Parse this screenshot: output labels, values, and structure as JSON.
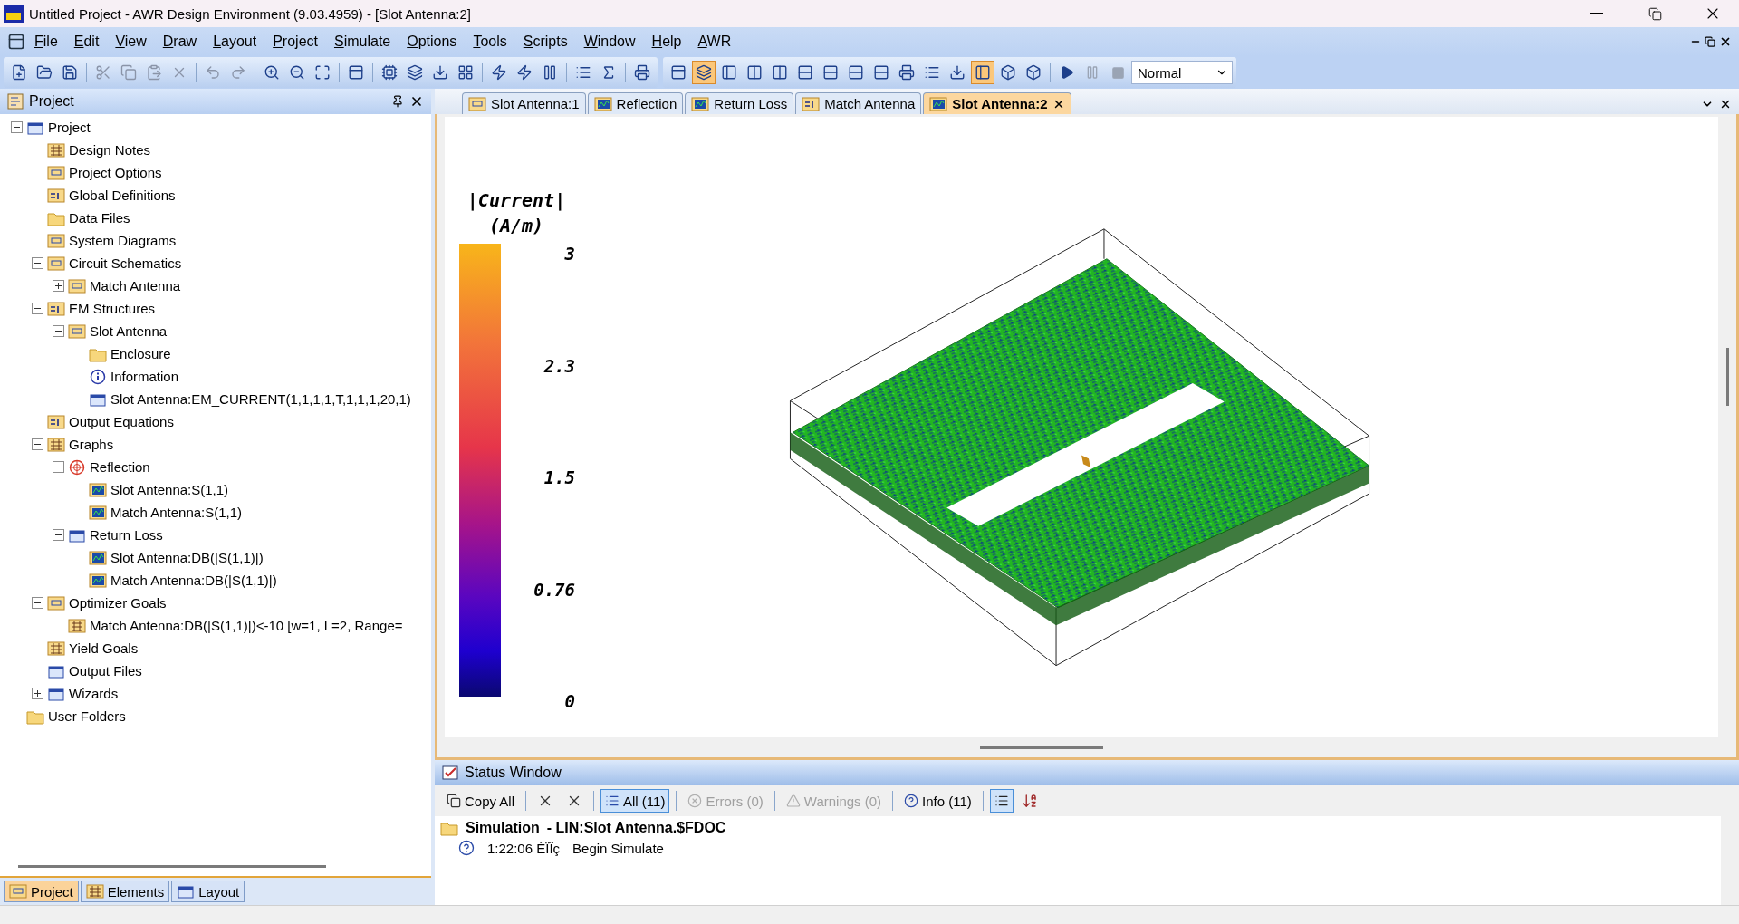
{
  "window": {
    "title": "Untitled Project - AWR Design Environment (9.03.4959) - [Slot Antenna:2]"
  },
  "menu": [
    "File",
    "Edit",
    "View",
    "Draw",
    "Layout",
    "Project",
    "Simulate",
    "Options",
    "Tools",
    "Scripts",
    "Window",
    "Help",
    "AWR"
  ],
  "toolbar": {
    "view_buttons": [
      {
        "active": false
      },
      {
        "active": true
      },
      {
        "active": false
      },
      {
        "active": false
      },
      {
        "active": false
      },
      {
        "active": false
      },
      {
        "active": false
      },
      {
        "active": false
      },
      {
        "active": false
      },
      {
        "active": false
      },
      {
        "active": false
      },
      {
        "active": false
      },
      {
        "active": true
      },
      {
        "active": false
      },
      {
        "active": false
      }
    ],
    "mode": "Normal"
  },
  "project_panel": {
    "title": "Project",
    "tree": [
      {
        "label": "Project",
        "kind": "box",
        "expanded": true,
        "children": [
          {
            "label": "Design Notes",
            "kind": "grid"
          },
          {
            "label": "Project Options",
            "kind": "document"
          },
          {
            "label": "Global Definitions",
            "kind": "equation"
          },
          {
            "label": "Data Files",
            "kind": "folder"
          },
          {
            "label": "System Diagrams",
            "kind": "document"
          },
          {
            "label": "Circuit Schematics",
            "kind": "document",
            "expanded": true,
            "children": [
              {
                "label": "Match Antenna",
                "kind": "document",
                "expanded": false
              }
            ]
          },
          {
            "label": "EM Structures",
            "kind": "equation",
            "expanded": true,
            "children": [
              {
                "label": "Slot Antenna",
                "kind": "document",
                "expanded": true,
                "children": [
                  {
                    "label": "Enclosure",
                    "kind": "folder"
                  },
                  {
                    "label": "Information",
                    "kind": "info"
                  },
                  {
                    "label": "Slot Antenna:EM_CURRENT(1,1,1,1,T,1,1,1,20,1)",
                    "kind": "box"
                  }
                ]
              }
            ]
          },
          {
            "label": "Output Equations",
            "kind": "equation"
          },
          {
            "label": "Graphs",
            "kind": "grid",
            "expanded": true,
            "children": [
              {
                "label": "Reflection",
                "kind": "smith",
                "expanded": true,
                "children": [
                  {
                    "label": "Slot Antenna:S(1,1)",
                    "kind": "chart"
                  },
                  {
                    "label": "Match Antenna:S(1,1)",
                    "kind": "chart"
                  }
                ]
              },
              {
                "label": "Return Loss",
                "kind": "box",
                "expanded": true,
                "children": [
                  {
                    "label": "Slot Antenna:DB(|S(1,1)|)",
                    "kind": "chart"
                  },
                  {
                    "label": "Match Antenna:DB(|S(1,1)|)",
                    "kind": "chart"
                  }
                ]
              }
            ]
          },
          {
            "label": "Optimizer Goals",
            "kind": "document",
            "expanded": true,
            "children": [
              {
                "label": "Match Antenna:DB(|S(1,1)|)<-10 [w=1, L=2, Range=",
                "kind": "grid"
              }
            ]
          },
          {
            "label": "Yield Goals",
            "kind": "grid"
          },
          {
            "label": "Output Files",
            "kind": "box"
          },
          {
            "label": "Wizards",
            "kind": "box",
            "expanded": false
          }
        ]
      },
      {
        "label": "User Folders",
        "kind": "folder"
      }
    ],
    "tabs": [
      {
        "label": "Project",
        "selected": true
      },
      {
        "label": "Elements",
        "selected": false
      },
      {
        "label": "Layout",
        "selected": false
      }
    ]
  },
  "document_tabs": [
    {
      "label": "Slot Antenna:1",
      "selected": false
    },
    {
      "label": "Reflection",
      "selected": false
    },
    {
      "label": "Return Loss",
      "selected": false
    },
    {
      "label": "Match Antenna",
      "selected": false
    },
    {
      "label": "Slot Antenna:2",
      "selected": true
    }
  ],
  "legend": {
    "title": "|Current|",
    "unit": "(A/m)",
    "ticks": [
      "3",
      "2.3",
      "1.5",
      "0.76",
      "0"
    ]
  },
  "status_window": {
    "title": "Status Window",
    "copy_label": "Copy All",
    "filters": [
      {
        "label": "All (11)",
        "selected": true,
        "disabled": false
      },
      {
        "label": "Errors (0)",
        "selected": false,
        "disabled": true
      },
      {
        "label": "Warnings (0)",
        "selected": false,
        "disabled": true
      },
      {
        "label": "Info (11)",
        "selected": false,
        "disabled": false
      }
    ],
    "group": {
      "name": "Simulation",
      "detail": "- LIN:Slot Antenna.$FDOC"
    },
    "messages": [
      {
        "time": "1:22:06 ÉÏÎç",
        "text": "Begin Simulate"
      }
    ]
  }
}
